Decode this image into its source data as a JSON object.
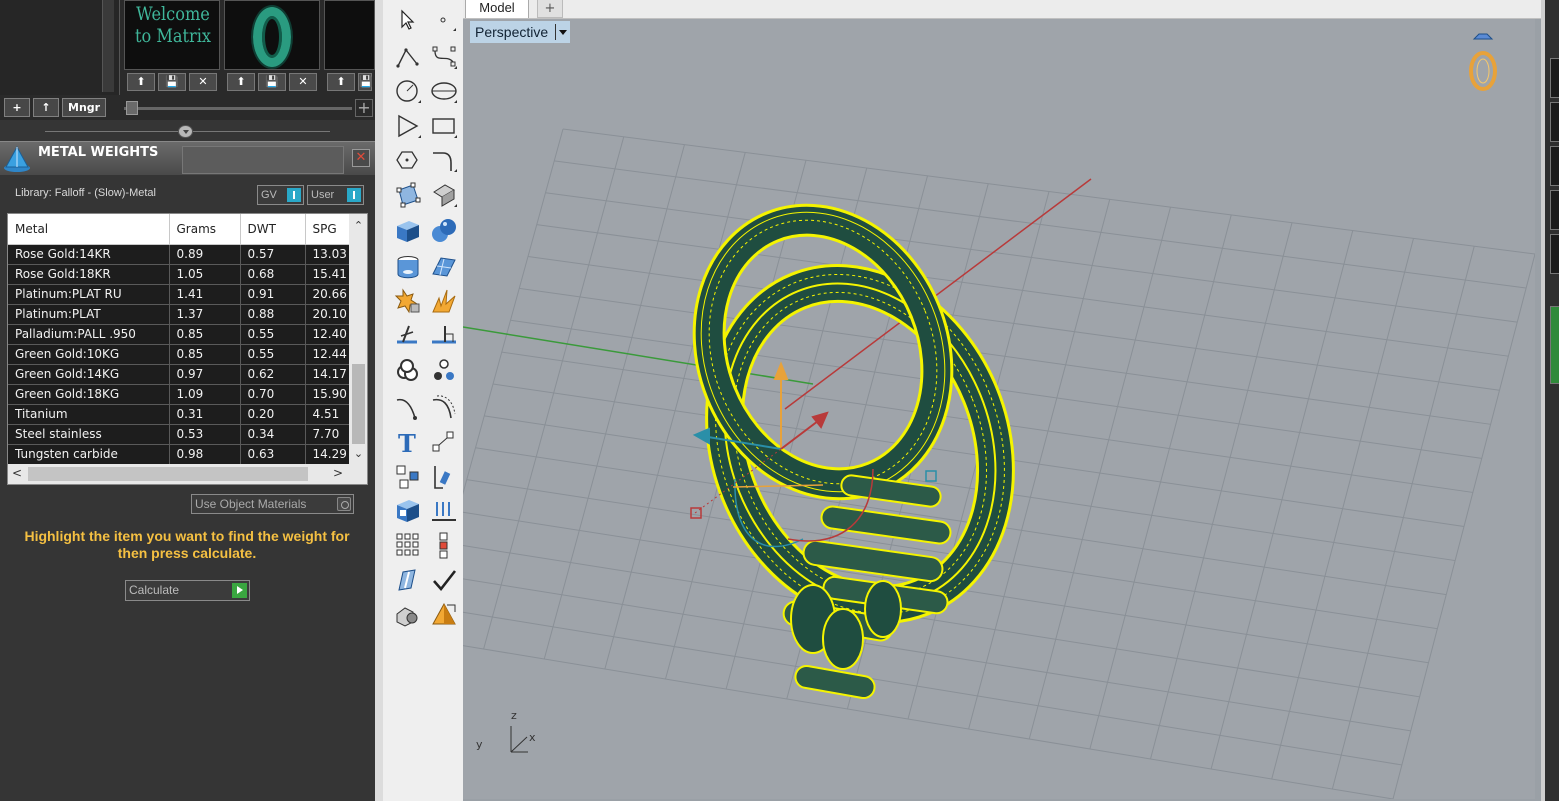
{
  "thumbnails": [
    {
      "caption": "Welcome to Matrix"
    },
    {
      "caption": ""
    }
  ],
  "thumb_buttons": [
    "⬆",
    "💾",
    "✕"
  ],
  "nav": {
    "add": "+",
    "up": "↑",
    "manager": "Mngr",
    "plus_right": "+"
  },
  "metal_weights": {
    "title": "METAL WEIGHTS",
    "close": "✕",
    "library": "Library: Falloff - (Slow)-Metal",
    "toggle_gv": "GV",
    "toggle_user": "User",
    "columns": [
      "Metal",
      "Grams",
      "DWT",
      "SPG"
    ],
    "rows": [
      [
        "Rose Gold:14KR",
        "0.89",
        "0.57",
        "13.03"
      ],
      [
        "Rose Gold:18KR",
        "1.05",
        "0.68",
        "15.41"
      ],
      [
        "Platinum:PLAT RU",
        "1.41",
        "0.91",
        "20.66"
      ],
      [
        "Platinum:PLAT",
        "1.37",
        "0.88",
        "20.10"
      ],
      [
        "Palladium:PALL .950",
        "0.85",
        "0.55",
        "12.40"
      ],
      [
        "Green Gold:10KG",
        "0.85",
        "0.55",
        "12.44"
      ],
      [
        "Green Gold:14KG",
        "0.97",
        "0.62",
        "14.17"
      ],
      [
        "Green Gold:18KG",
        "1.09",
        "0.70",
        "15.90"
      ],
      [
        "Titanium",
        "0.31",
        "0.20",
        "4.51"
      ],
      [
        "Steel stainless",
        "0.53",
        "0.34",
        "7.70"
      ],
      [
        "Tungsten carbide",
        "0.98",
        "0.63",
        "14.29"
      ]
    ],
    "use_object_materials": "Use Object Materials",
    "instruction": "Highlight the item you want to find the weight for then press calculate.",
    "calculate": "Calculate"
  },
  "viewport": {
    "tab_model": "Model",
    "tab_add": "+",
    "view_name": "Perspective",
    "axis_labels": {
      "x": "x",
      "y": "y",
      "z": "z"
    }
  },
  "colors": {
    "selection_yellow": "#f4f400",
    "grid_line": "#8a9097",
    "axis_red": "#b83a3a",
    "axis_green": "#3a9a3a",
    "accent_orange": "#f5c042"
  }
}
